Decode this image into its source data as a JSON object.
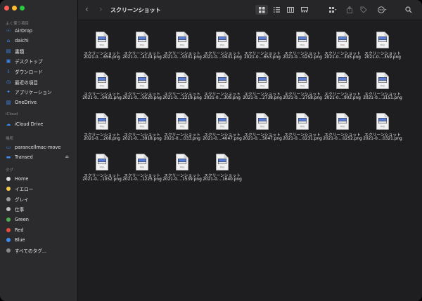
{
  "window": {
    "title": "スクリーンショット",
    "traffic": {
      "close": "#ff5f57",
      "minimize": "#febc2e",
      "zoom": "#28c840"
    }
  },
  "toolbar": {
    "back_icon": "chevron-left-icon",
    "forward_icon": "chevron-right-icon"
  },
  "sidebar": {
    "favorites_title": "よく使う項目",
    "favorites": [
      {
        "label": "AirDrop",
        "icon": "airdrop-icon"
      },
      {
        "label": "daichi",
        "icon": "home-icon"
      },
      {
        "label": "書類",
        "icon": "document-icon"
      },
      {
        "label": "デスクトップ",
        "icon": "desktop-icon"
      },
      {
        "label": "ダウンロード",
        "icon": "download-icon"
      },
      {
        "label": "最近の項目",
        "icon": "clock-icon"
      },
      {
        "label": "アプリケーション",
        "icon": "applications-icon"
      },
      {
        "label": "OneDrive",
        "icon": "folder-icon"
      }
    ],
    "icloud_title": "iCloud",
    "icloud": [
      {
        "label": "iCloud Drive",
        "icon": "cloud-icon"
      }
    ],
    "locations_title": "場所",
    "locations": [
      {
        "label": "parancellmac-move",
        "icon": "laptop-icon"
      },
      {
        "label": "Transed",
        "icon": "drive-icon"
      }
    ],
    "tags_title": "タグ",
    "tags": [
      {
        "label": "Home",
        "color": "#dcdcdc"
      },
      {
        "label": "イエロー",
        "color": "#f2c94c"
      },
      {
        "label": "グレイ",
        "color": "#9b9b9b"
      },
      {
        "label": "仕事",
        "color": "#bdbdbd"
      },
      {
        "label": "Green",
        "color": "#4caf50"
      },
      {
        "label": "Red",
        "color": "#e74c3c"
      },
      {
        "label": "Blue",
        "color": "#3b8cf5"
      },
      {
        "label": "すべてのタグ...",
        "color": "#888888"
      }
    ]
  },
  "files": [
    {
      "line1": "スクリーンショット",
      "line2": "2021-0....656.png"
    },
    {
      "line1": "スクリーンショット",
      "line2": "2021-0....4124.png"
    },
    {
      "line1": "スクリーンショット",
      "line2": "2021-0....0331.png"
    },
    {
      "line1": "スクリーンショット",
      "line2": "2021-0....0431.png"
    },
    {
      "line1": "スクリーンショット",
      "line2": "2021-0....653.png"
    },
    {
      "line1": "スクリーンショット",
      "line2": "2021-0....0252.png"
    },
    {
      "line1": "スクリーンショット",
      "line2": "2021-0....335.png"
    },
    {
      "line1": "スクリーンショット",
      "line2": "2021-0....359.png"
    },
    {
      "line1": "スクリーンショット",
      "line2": "2021-0....0431.png"
    },
    {
      "line1": "スクリーンショット",
      "line2": "2021-0....0520.png"
    },
    {
      "line1": "スクリーンショット",
      "line2": "2021-0....2219.png"
    },
    {
      "line1": "スクリーンショット",
      "line2": "2021-0....309.png"
    },
    {
      "line1": "スクリーンショット",
      "line2": "2021-0....2738.png"
    },
    {
      "line1": "スクリーンショット",
      "line2": "2021-0....2758.png"
    },
    {
      "line1": "スクリーンショット",
      "line2": "2021-0....902.png"
    },
    {
      "line1": "スクリーンショット",
      "line2": "2021-0....3151.png"
    },
    {
      "line1": "スクリーンショット",
      "line2": "2021-0....208.png"
    },
    {
      "line1": "スクリーンショット",
      "line2": "2021-0....3918.png"
    },
    {
      "line1": "スクリーンショット",
      "line2": "2021-0....033.png"
    },
    {
      "line1": "スクリーンショット",
      "line2": "2021-0....4047.png"
    },
    {
      "line1": "スクリーンショット",
      "line2": "2021-0....5047.png"
    },
    {
      "line1": "スクリーンショット",
      "line2": "2021-0....0231.png"
    },
    {
      "line1": "スクリーンショット",
      "line2": "2021-0....0252.png"
    },
    {
      "line1": "スクリーンショット",
      "line2": "2021-0....0321.png"
    },
    {
      "line1": "スクリーンショット",
      "line2": "2021-0....1052.png"
    },
    {
      "line1": "スクリーンショット",
      "line2": "2021-0....1225.png"
    },
    {
      "line1": "スクリーンショット",
      "line2": "2021-0....1539.png"
    },
    {
      "line1": "スクリーンショット",
      "line2": "2021-0....1640.png"
    }
  ],
  "file_badge": "PNG"
}
